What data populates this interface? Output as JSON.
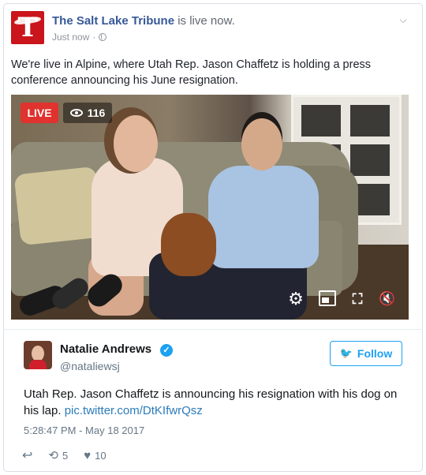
{
  "facebook_post": {
    "page_name": "The Salt Lake Tribune",
    "status_text": "is live now.",
    "timestamp": "Just now",
    "separator": "·",
    "chevron": "⌵",
    "avatar_letter": "T",
    "text": "We're live in Alpine, where Utah Rep. Jason Chaffetz is holding a press conference announcing his June resignation.",
    "video": {
      "live_label": "LIVE",
      "viewer_count": "116",
      "controls": [
        "gear-icon",
        "pip-icon",
        "fullscreen-icon",
        "mute-icon"
      ]
    }
  },
  "tweet": {
    "author_name": "Natalie Andrews",
    "handle": "@nataliewsj",
    "verified": true,
    "follow_label": "Follow",
    "text": "Utah Rep. Jason Chaffetz is announcing his resignation with his dog on his lap.",
    "link_text": "pic.twitter.com/DtKIfwrQsz",
    "timestamp": "5:28:47 PM - May 18 2017",
    "retweet_count": "5",
    "like_count": "10"
  },
  "colors": {
    "facebook_link": "#365899",
    "live_red": "#e0322e",
    "twitter_blue": "#1da1f2",
    "tribune_red": "#c9151b"
  }
}
